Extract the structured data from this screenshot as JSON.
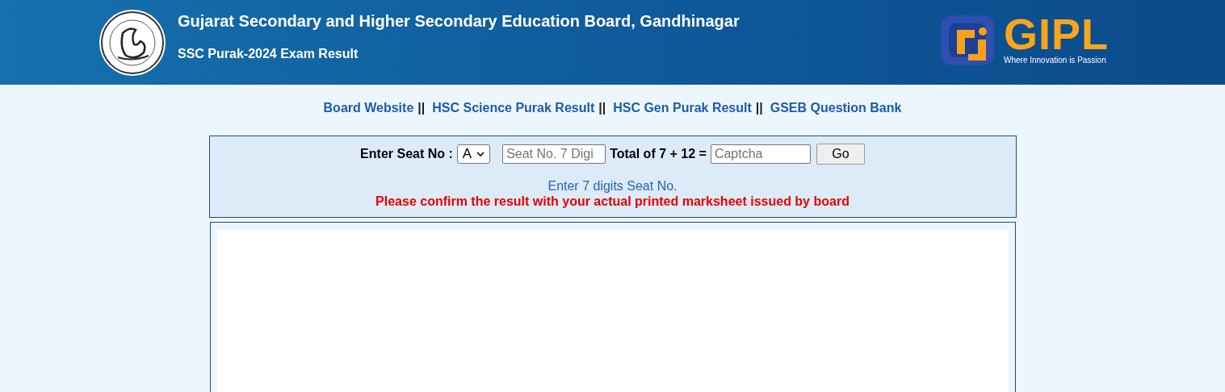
{
  "header": {
    "title": "Gujarat Secondary and Higher Secondary Education Board, Gandhinagar",
    "subtitle": "SSC Purak-2024 Exam Result",
    "partner_logo": {
      "name": "GIPL",
      "tagline": "Where Innovation is Passion"
    }
  },
  "nav_links": [
    {
      "label": "Board Website",
      "separator": "||"
    },
    {
      "label": "HSC Science Purak Result",
      "separator": "||"
    },
    {
      "label": "HSC Gen Purak Result",
      "separator": "||"
    },
    {
      "label": "GSEB Question Bank"
    }
  ],
  "form": {
    "seat_label": "Enter Seat No :",
    "series_value": "A",
    "seat_placeholder": "Seat No. 7 Digi",
    "captcha_label": "Total of 7 + 12 =",
    "captcha_placeholder": "Captcha",
    "submit": "Go",
    "hint": "Enter 7 digits Seat No.",
    "warning": "Please confirm the result with your actual printed marksheet issued by board"
  }
}
